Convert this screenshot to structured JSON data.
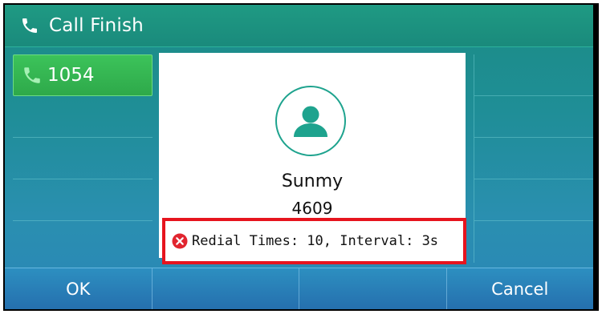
{
  "title_bar": {
    "title": "Call Finish",
    "icon": "phone-icon"
  },
  "line_keys_left": [
    {
      "label": "1054",
      "icon": "phone-icon",
      "active": true
    },
    {
      "label": ""
    },
    {
      "label": ""
    },
    {
      "label": ""
    },
    {
      "label": ""
    }
  ],
  "line_keys_right": [
    {
      "label": ""
    },
    {
      "label": ""
    },
    {
      "label": ""
    },
    {
      "label": ""
    },
    {
      "label": ""
    }
  ],
  "contact": {
    "name": "Sunmy",
    "number": "4609",
    "avatar_icon": "user-icon"
  },
  "redial": {
    "text": "Redial Times: 10, Interval: 3s",
    "icon": "error-icon"
  },
  "softkeys": [
    "OK",
    "",
    "",
    "Cancel"
  ],
  "colors": {
    "title_bar": "#1a8a7c",
    "active_line": "#34b652",
    "softkey_bar": "#2a80b8",
    "highlight_border": "#e6141e",
    "accent": "#1ea38e"
  }
}
